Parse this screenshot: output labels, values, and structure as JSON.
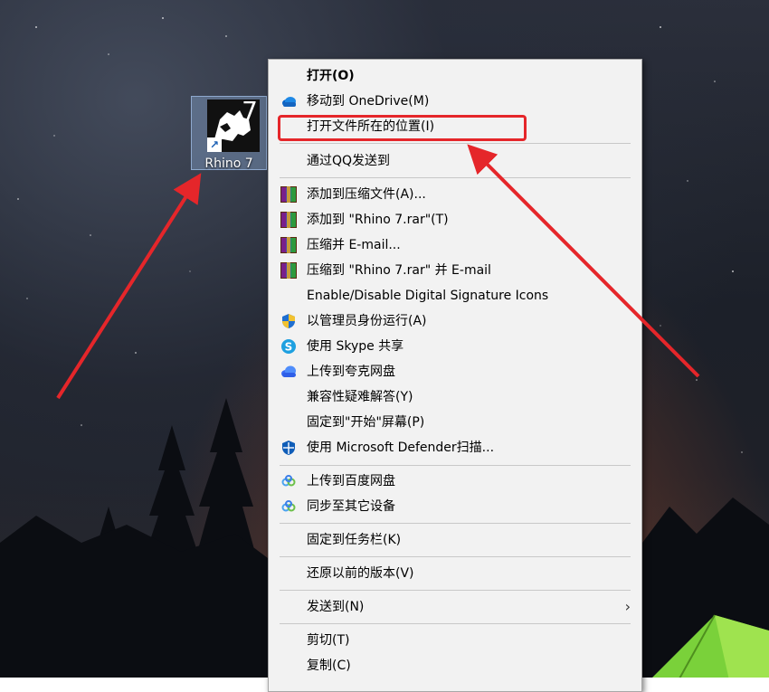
{
  "desktop_icon": {
    "label": "Rhino 7",
    "badge": "7",
    "shortcut_glyph": "↗"
  },
  "menu": {
    "items": [
      {
        "label": "打开(O)",
        "bold": true,
        "icon": ""
      },
      {
        "label": "移动到 OneDrive(M)",
        "icon": "onedrive-icon"
      },
      {
        "label": "打开文件所在的位置(I)",
        "icon": ""
      },
      {
        "label": "通过QQ发送到",
        "icon": ""
      },
      {
        "label": "添加到压缩文件(A)...",
        "icon": "winrar-icon"
      },
      {
        "label": "添加到 \"Rhino 7.rar\"(T)",
        "icon": "winrar-icon"
      },
      {
        "label": "压缩并 E-mail...",
        "icon": "winrar-icon"
      },
      {
        "label": "压缩到 \"Rhino 7.rar\" 并 E-mail",
        "icon": "winrar-icon"
      },
      {
        "label": "Enable/Disable Digital Signature Icons",
        "icon": ""
      },
      {
        "label": "以管理员身份运行(A)",
        "icon": "uac-shield-icon"
      },
      {
        "label": "使用 Skype 共享",
        "icon": "skype-icon"
      },
      {
        "label": "上传到夸克网盘",
        "icon": "quark-cloud-icon"
      },
      {
        "label": "兼容性疑难解答(Y)",
        "icon": ""
      },
      {
        "label": "固定到\"开始\"屏幕(P)",
        "icon": ""
      },
      {
        "label": "使用 Microsoft Defender扫描...",
        "icon": "defender-icon"
      },
      {
        "label": "上传到百度网盘",
        "icon": "baidu-netdisk-icon"
      },
      {
        "label": "同步至其它设备",
        "icon": "baidu-netdisk-icon"
      },
      {
        "label": "固定到任务栏(K)",
        "icon": ""
      },
      {
        "label": "还原以前的版本(V)",
        "icon": ""
      },
      {
        "label": "发送到(N)",
        "icon": "",
        "submenu_arrow": "›"
      },
      {
        "label": "剪切(T)",
        "icon": ""
      },
      {
        "label": "复制(C)",
        "icon": ""
      }
    ]
  },
  "colors": {
    "highlight_box": "#e5262a",
    "arrow": "#e5262a",
    "menu_bg": "#f2f2f2"
  }
}
